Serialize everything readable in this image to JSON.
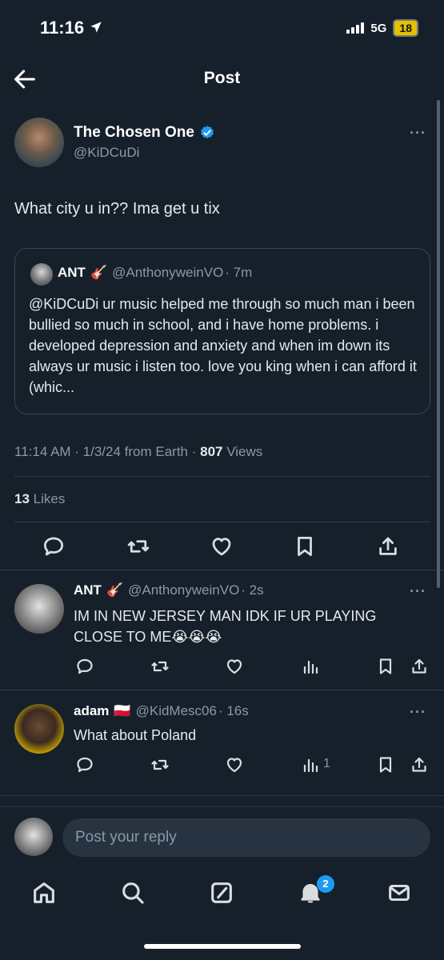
{
  "status_bar": {
    "time": "11:16",
    "network": "5G",
    "battery": "18"
  },
  "header": {
    "title": "Post"
  },
  "post": {
    "author_name": "The Chosen One",
    "author_handle": "@KiDCuDi",
    "more": "···",
    "text": "What city u in?? Ima get u tix",
    "quote": {
      "name": "ANT",
      "emoji": "🎸",
      "handle": "@AnthonyweinVO",
      "time": "· 7m",
      "text": "@KiDCuDi ur music helped me through so much man i been bullied so much in school, and i have home problems. i developed depression and anxiety and when im down its always ur music i listen too. love you king when i can afford it (whic..."
    },
    "meta_time": "11:14 AM · 1/3/24 from Earth · ",
    "views_count": "807",
    "views_label": " Views",
    "likes_count": "13",
    "likes_label": " Likes"
  },
  "replies": [
    {
      "name": "ANT",
      "emoji": "🎸",
      "handle": "@AnthonyweinVO",
      "time": "· 2s",
      "text": "IM IN NEW JERSEY MAN IDK IF UR PLAYING CLOSE TO ME😭😭😭",
      "views": ""
    },
    {
      "name": "adam",
      "emoji": "🇵🇱",
      "handle": "@KidMesc06",
      "time": "· 16s",
      "text": "What about Poland",
      "views": "1"
    }
  ],
  "composer": {
    "placeholder": "Post your reply"
  },
  "bottom_nav": {
    "notification_count": "2"
  },
  "colors": {
    "background": "#15202b",
    "accent": "#1d9bf0",
    "muted": "#8b98a5"
  }
}
